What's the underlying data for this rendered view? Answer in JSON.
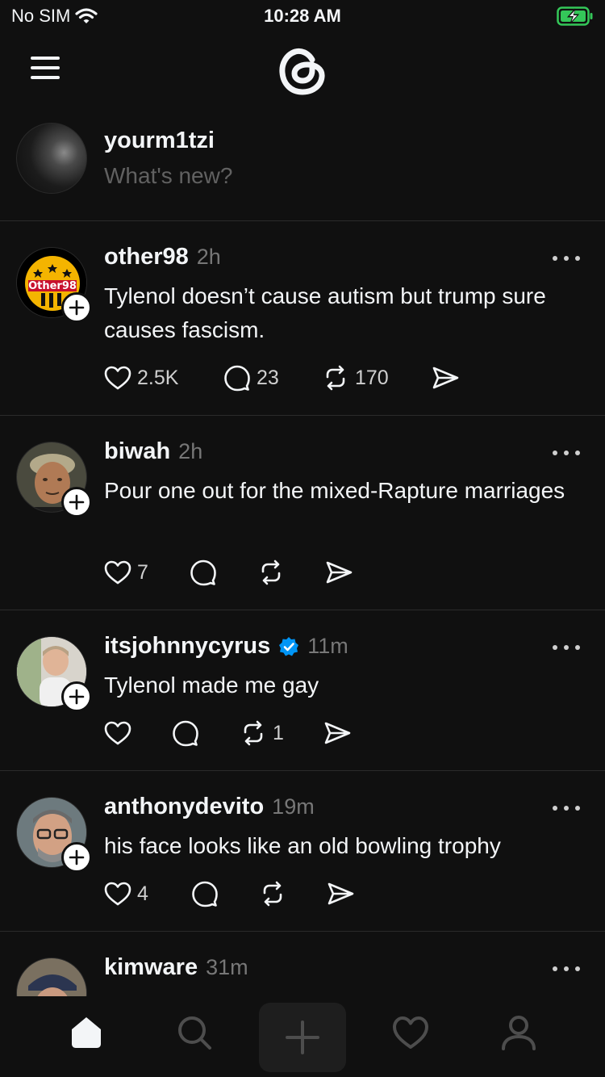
{
  "status_bar": {
    "carrier": "No SIM",
    "time": "10:28 AM"
  },
  "composer": {
    "username": "yourm1tzi",
    "placeholder": "What's new?"
  },
  "posts": [
    {
      "username": "other98",
      "time": "2h",
      "verified": false,
      "text": "Tylenol doesn’t cause autism but trump sure causes fascism.",
      "likes": "2.5K",
      "replies": "23",
      "reposts": "170",
      "avatar_text": "Other98"
    },
    {
      "username": "biwah",
      "time": "2h",
      "verified": false,
      "text": "Pour one out for the mixed-Rapture marriages",
      "likes": "7",
      "replies": "",
      "reposts": ""
    },
    {
      "username": "itsjohnnycyrus",
      "time": "11m",
      "verified": true,
      "text": "Tylenol made me gay",
      "likes": "",
      "replies": "",
      "reposts": "1"
    },
    {
      "username": "anthonydevito",
      "time": "19m",
      "verified": false,
      "text": "his face looks like an old bowling trophy",
      "likes": "4",
      "replies": "",
      "reposts": ""
    },
    {
      "username": "kimware",
      "time": "31m",
      "verified": false,
      "text": "",
      "likes": "",
      "replies": "",
      "reposts": ""
    }
  ],
  "nav": {
    "active": "home"
  },
  "colors": {
    "background": "#101010",
    "text": "#f3f5f7",
    "secondary": "#777777",
    "verified": "#0095f6",
    "battery": "#34c759"
  }
}
